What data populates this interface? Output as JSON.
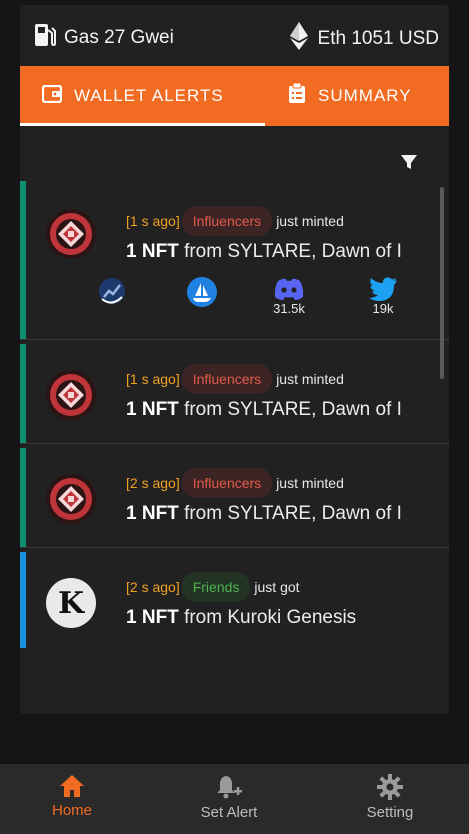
{
  "topbar": {
    "gas_label": "Gas 27 Gwei",
    "eth_label": "Eth 1051 USD"
  },
  "tabs": [
    {
      "label": "WALLET ALERTS",
      "icon": "wallet-icon",
      "active": true
    },
    {
      "label": "SUMMARY",
      "icon": "clipboard-icon",
      "active": false
    }
  ],
  "colors": {
    "accent": "#f26b22",
    "mint_bar": "#0f8f72",
    "got_bar": "#1a90e0"
  },
  "feed": [
    {
      "time": "[1 s ago]",
      "group": "Influencers",
      "action": "just minted",
      "qty": "1 NFT",
      "from_text": "from SYLTARE, Dawn of I",
      "avatar": "syltare-logo",
      "links": [
        {
          "icon": "chart-icon",
          "count": ""
        },
        {
          "icon": "opensea-icon",
          "count": ""
        },
        {
          "icon": "discord-icon",
          "count": "31.5k"
        },
        {
          "icon": "twitter-icon",
          "count": "19k"
        }
      ]
    },
    {
      "time": "[1 s ago]",
      "group": "Influencers",
      "action": "just minted",
      "qty": "1 NFT",
      "from_text": "from SYLTARE, Dawn of I",
      "avatar": "syltare-logo"
    },
    {
      "time": "[2 s ago]",
      "group": "Influencers",
      "action": "just minted",
      "qty": "1 NFT",
      "from_text": "from SYLTARE, Dawn of I",
      "avatar": "syltare-logo"
    },
    {
      "time": "[2 s ago]",
      "group": "Friends",
      "action": "just got",
      "qty": "1 NFT",
      "from_text": "from Kuroki Genesis",
      "avatar": "kuroki-logo",
      "avatar_letter": "K"
    }
  ],
  "nav": [
    {
      "label": "Home",
      "icon": "home-icon",
      "active": true
    },
    {
      "label": "Set Alert",
      "icon": "bell-plus-icon",
      "active": false
    },
    {
      "label": "Setting",
      "icon": "gear-icon",
      "active": false
    }
  ]
}
